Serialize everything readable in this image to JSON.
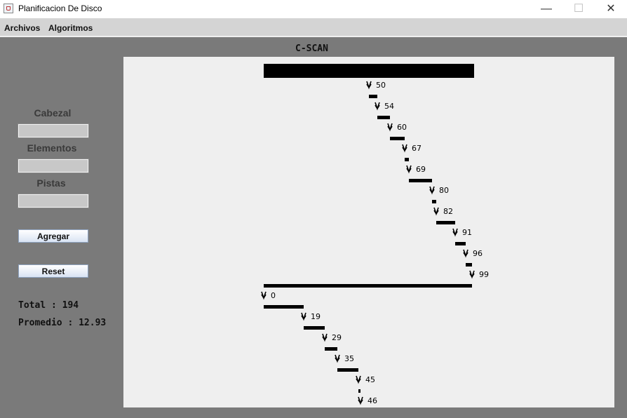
{
  "window": {
    "title": "Planificacion De Disco",
    "controls": [
      "minimize",
      "maximize",
      "close"
    ]
  },
  "menu": {
    "items": [
      "Archivos",
      "Algoritmos"
    ]
  },
  "sidebar": {
    "cabezal_label": "Cabezal",
    "elementos_label": "Elementos",
    "pistas_label": "Pistas",
    "cabezal_value": "",
    "elementos_value": "",
    "pistas_value": "",
    "agregar_label": "Agregar",
    "reset_label": "Reset",
    "total_text": "Total : 194",
    "promedio_text": "Promedio : 12.93"
  },
  "chart": {
    "algorithm_title": "C-SCAN",
    "sequence": [
      50,
      54,
      60,
      67,
      69,
      80,
      82,
      91,
      96,
      99,
      0,
      19,
      29,
      35,
      45,
      46
    ]
  }
}
